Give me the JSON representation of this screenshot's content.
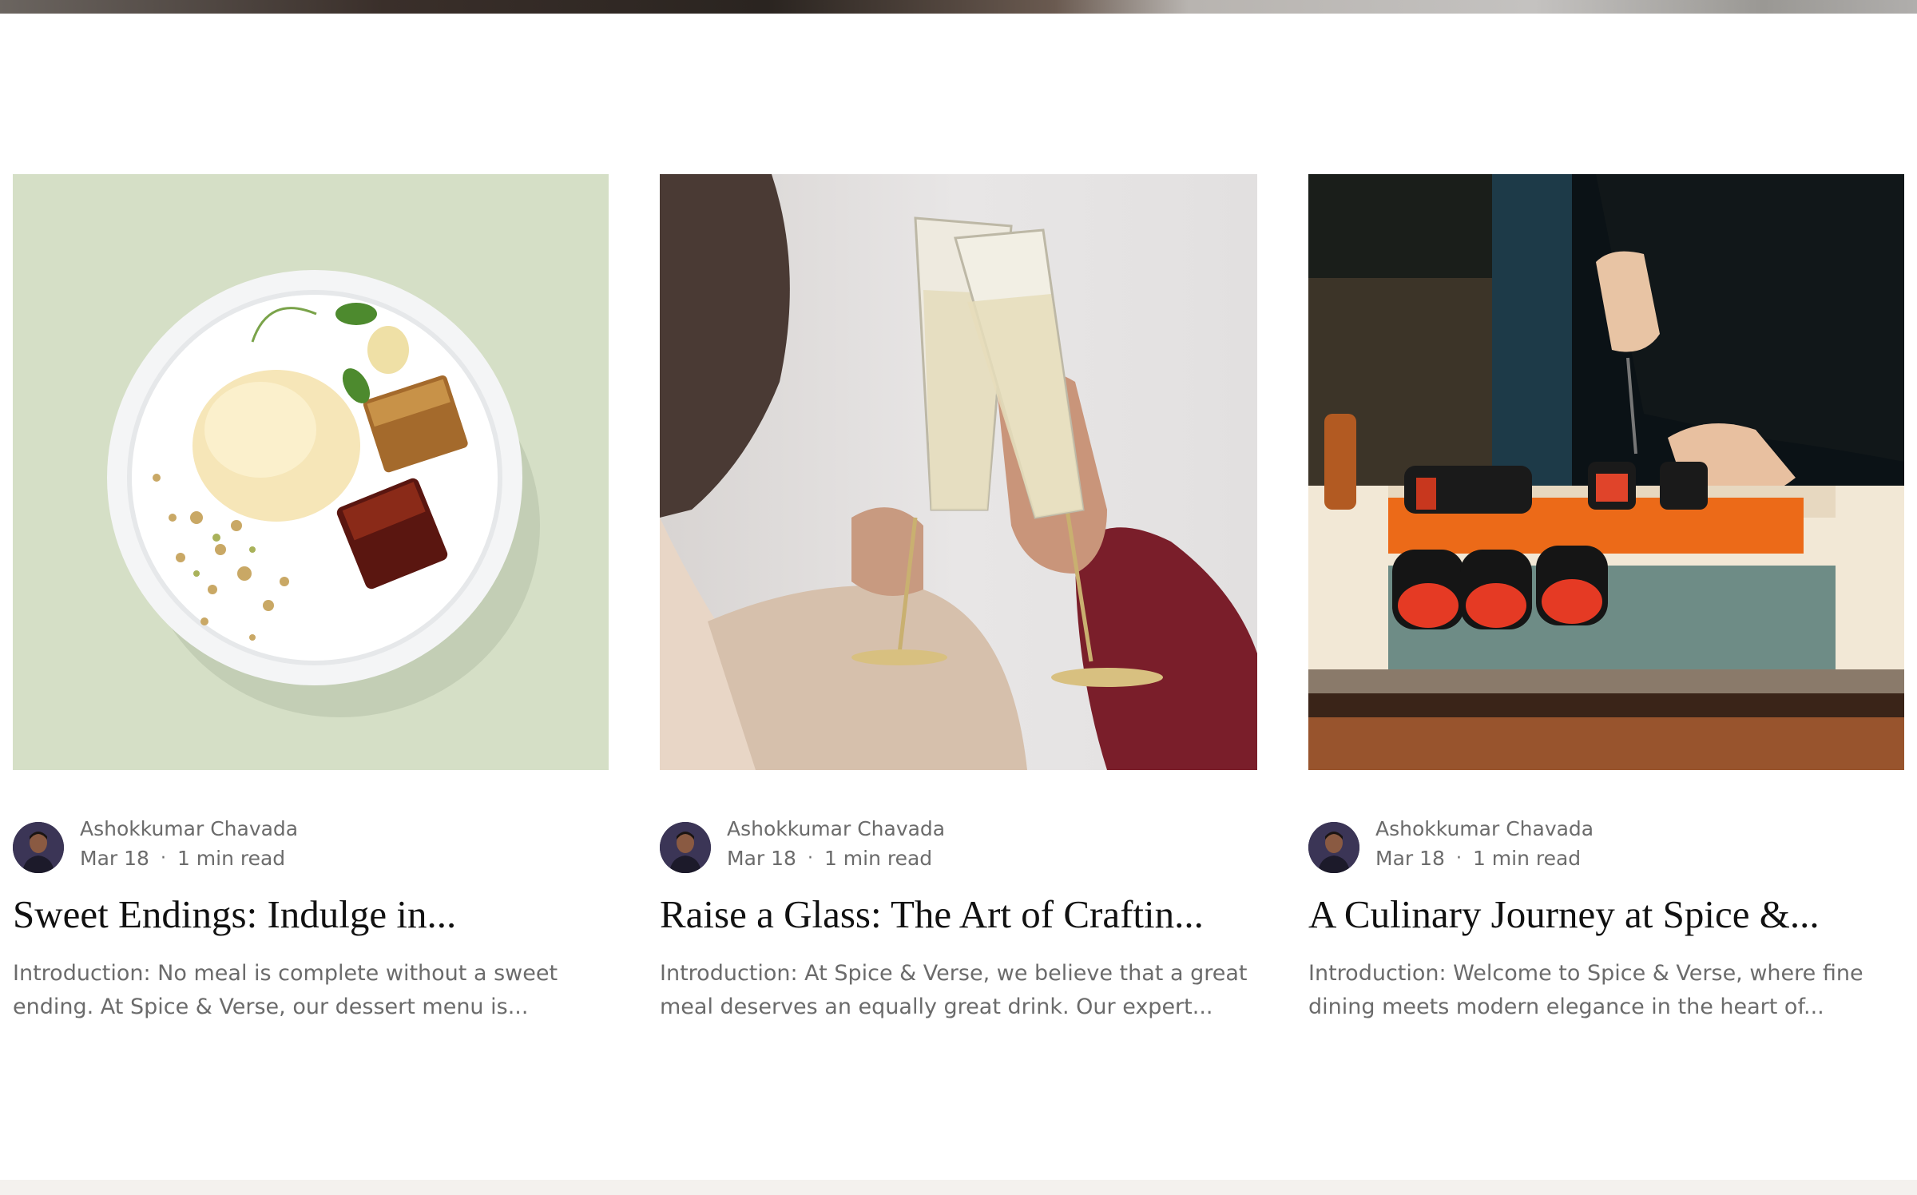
{
  "posts": [
    {
      "author": "Ashokkumar Chavada",
      "date": "Mar 18",
      "read_time": "1 min read",
      "title": "Sweet Endings: Indulge in...",
      "excerpt": "Introduction: No meal is complete without a sweet ending. At Spice & Verse, our dessert menu is...",
      "image": "dessert-plate"
    },
    {
      "author": "Ashokkumar Chavada",
      "date": "Mar 18",
      "read_time": "1 min read",
      "title": "Raise a Glass: The Art of Craftin...",
      "excerpt": "Introduction: At Spice & Verse, we believe that a great meal deserves an equally great drink. Our expert...",
      "image": "champagne-toast"
    },
    {
      "author": "Ashokkumar Chavada",
      "date": "Mar 18",
      "read_time": "1 min read",
      "title": "A Culinary Journey at Spice &...",
      "excerpt": "Introduction: Welcome to Spice & Verse, where fine dining meets modern elegance in the heart of...",
      "image": "sushi-chef"
    }
  ],
  "separator": "·"
}
